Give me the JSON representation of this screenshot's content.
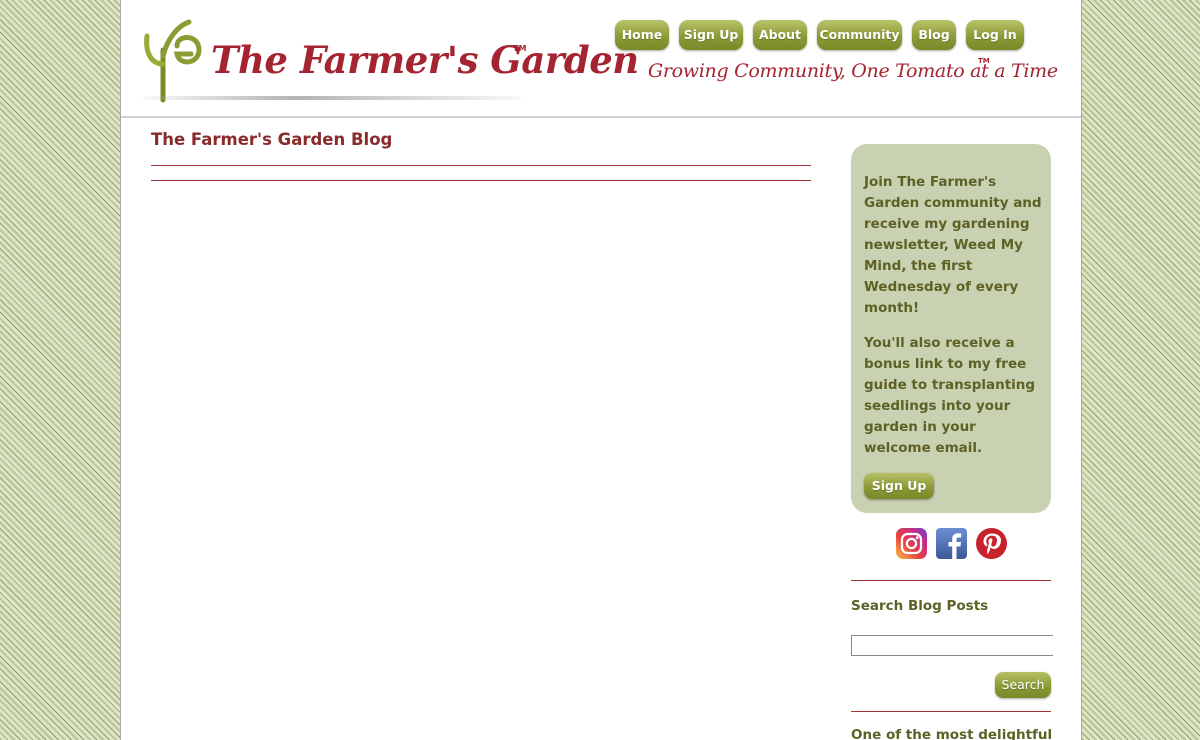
{
  "header": {
    "logo_text": "The Farmer's Garden",
    "logo_tm": "TM",
    "tagline": "Growing Community, One Tomato at a Time",
    "tagline_tm": "TM"
  },
  "nav": {
    "items": [
      {
        "label": "Home"
      },
      {
        "label": "Sign Up"
      },
      {
        "label": "About"
      },
      {
        "label": "Community"
      },
      {
        "label": "Blog"
      },
      {
        "label": "Log In"
      }
    ]
  },
  "main": {
    "title": "The Farmer's Garden Blog"
  },
  "sidebar": {
    "signup_paragraph_1": "Join The Farmer's Garden community and receive my gardening newsletter, Weed My Mind, the first Wednesday of every month!",
    "signup_paragraph_2": "You'll also receive a bonus link to my free guide to transplanting seedlings into your garden in your welcome email.",
    "signup_button": "Sign Up",
    "social_icons": [
      "instagram-icon",
      "facebook-icon",
      "pinterest-icon"
    ],
    "search_label": "Search Blog Posts",
    "search_value": "",
    "search_button": "Search",
    "bottom_text": "One of the most delightful"
  },
  "colors": {
    "brand_red": "#a52432",
    "title_red": "#8b2a2a",
    "olive_button": "#8d9a36",
    "olive_text": "#5d6123",
    "sidebar_box": "#c9d1b3"
  }
}
